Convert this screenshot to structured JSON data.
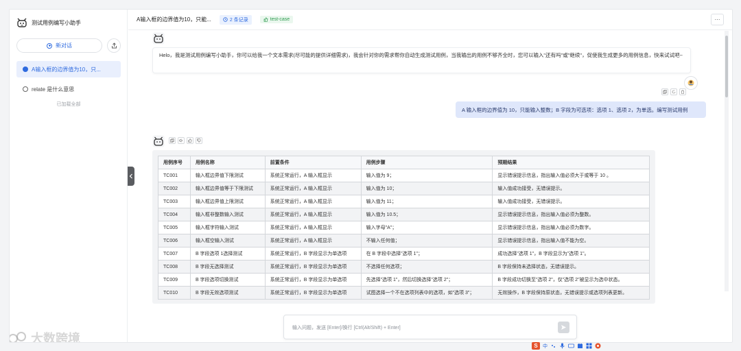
{
  "sidebar": {
    "app_title": "测试用例编写小助手",
    "new_chat_label": "新对话",
    "conversations": [
      {
        "label": "A输入框的边界值为10，只...",
        "active": true
      },
      {
        "label": "relate 是什么意思",
        "active": false
      }
    ],
    "loaded_all": "已加载全部"
  },
  "header": {
    "title": "A输入框的边界值为10，只能...",
    "records_badge": "2 条记录",
    "tag_badge": "test-case",
    "more_label": "···"
  },
  "messages": {
    "welcome": "Helo，我是测试用例编写小助手，你可以给我一个文本需求(尽可能的提供详细需求)，我会针对你的需求帮你自动生成测试用例，当我输出的用例不够齐全时，您可以输入\"还有吗\"或\"继续\"，促使我生成更多的用例信息，快来试试吧~",
    "user_query": "A 输入框的边界值为 10，只能输入整数；B 字段为可选项：选项 1、选项 2，为单选。编写测试用例"
  },
  "table": {
    "headers": [
      "用例序号",
      "用例名称",
      "前置条件",
      "用例步骤",
      "预期结果"
    ],
    "rows": [
      [
        "TC001",
        "输入框边界值下限测试",
        "系统正常运行，A 输入框显示",
        "输入值为 9；",
        "显示错误提示信息，指出输入值必须大于或等于 10 。"
      ],
      [
        "TC002",
        "输入框边界值等于下限测试",
        "系统正常运行，A 输入框显示",
        "输入值为 10；",
        "输入值成功接受，无错误提示。"
      ],
      [
        "TC003",
        "输入框边界值上限测试",
        "系统正常运行，A 输入框显示",
        "输入值为 11；",
        "输入值成功接受，无错误提示。"
      ],
      [
        "TC004",
        "输入框非整数输入测试",
        "系统正常运行，A 输入框显示",
        "输入值为 10.5；",
        "显示错误提示信息，指出输入值必须为整数。"
      ],
      [
        "TC005",
        "输入框字符输入测试",
        "系统正常运行，A 输入框显示",
        "输入字母\"A\"；",
        "显示错误提示信息，指出输入值必须为数字。"
      ],
      [
        "TC006",
        "输入框空输入测试",
        "系统正常运行，A 输入框显示",
        "不输入任何值；",
        "显示错误提示信息，指出输入值不能为空。"
      ],
      [
        "TC007",
        "B 字段选项 1选择测试",
        "系统正常运行，B 字段显示为单选项",
        "在 B 字段中选择\"选项 1\"；",
        "成功选择\"选项 1\"，B 字段显示为\"选项 1\"。"
      ],
      [
        "TC008",
        "B 字段无选择测试",
        "系统正常运行，B 字段显示为单选项",
        "不选择任何选项；",
        "B 字段保持未选择状态，无错误提示。"
      ],
      [
        "TC009",
        "B 字段选项切换测试",
        "系统正常运行，B 字段显示为单选项",
        "先选择\"选项 1\"，然后切换选择\"选项 2\"；",
        "B 字段成功切换至\"选项 2\"，仅\"选项 2\"被显示为选中状态。"
      ],
      [
        "TC010",
        "B 字段无效选项测试",
        "系统正常运行，B 字段显示为单选项",
        "试图选择一个不在选项列表中的选项，如\"选项 3\"；",
        "无效操作，B 字段保持原状态，无错误提示或选项列表更新。"
      ]
    ]
  },
  "input": {
    "placeholder": "输入问题，发送 [Enter]/换行 [Ctrl(Alt/Shift) + Enter]"
  },
  "watermark": "大数跨境",
  "ime": {
    "s_label": "S",
    "lang_label": "中"
  },
  "colors": {
    "accent": "#2f6bdf",
    "user_bubble": "#dfe7fb",
    "active_item_bg": "#e9effd"
  }
}
